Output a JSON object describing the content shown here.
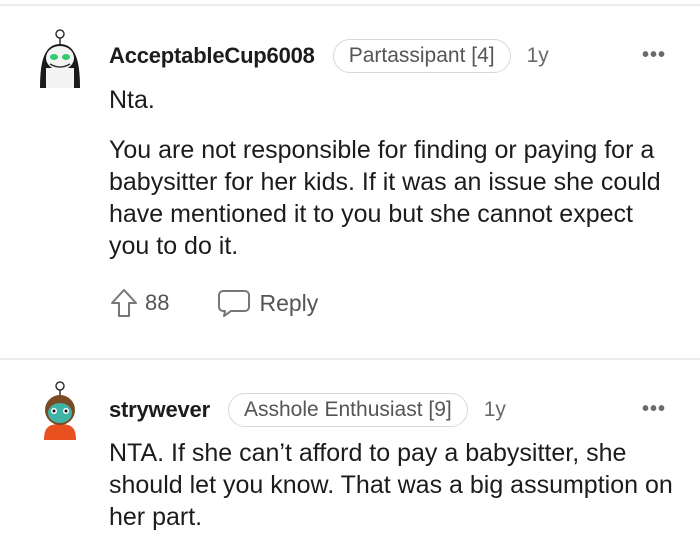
{
  "comments": [
    {
      "username": "AcceptableCup6008",
      "flair": "Partassipant [4]",
      "age": "1y",
      "paragraphs": [
        "Nta.",
        "You are not responsible for finding or paying for a babysitter for her kids. If it was an issue she could have mentioned it to you but she cannot expect you to do it."
      ],
      "votes": "88",
      "reply_label": "Reply"
    },
    {
      "username": "strywever",
      "flair": "Asshole Enthusiast [9]",
      "age": "1y",
      "paragraphs": [
        "NTA. If she can’t afford to pay a babysitter, she should let you know. That was a big assumption on her part."
      ]
    }
  ],
  "icons": {
    "more": "more-options-icon",
    "upvote": "upvote-arrow-icon",
    "reply": "speech-bubble-icon"
  }
}
